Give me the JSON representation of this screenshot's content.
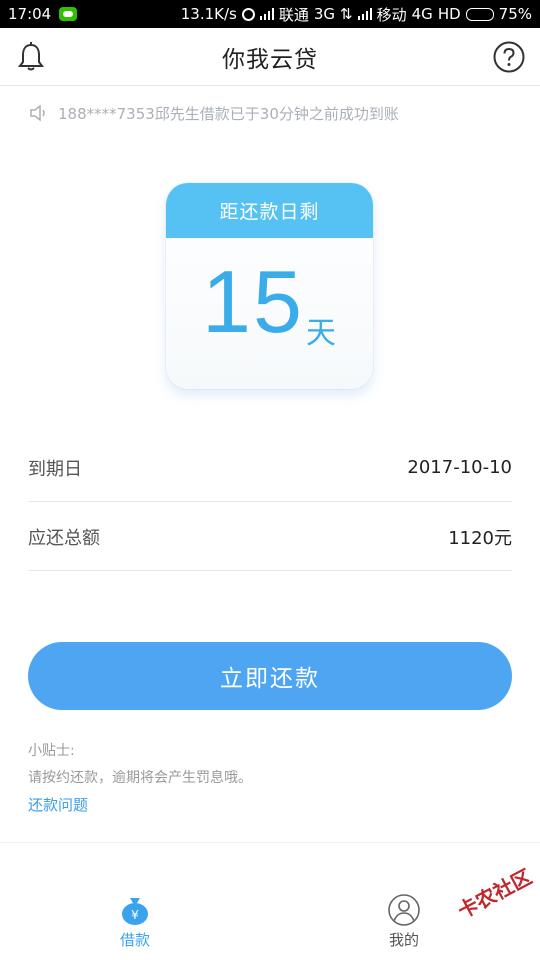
{
  "status_bar": {
    "time": "17:04",
    "net_speed": "13.1K/s",
    "carrier1": "联通",
    "net1": "3G",
    "carrier2": "移动",
    "net2": "4G",
    "hd": "HD",
    "battery": "75%",
    "battery_level": 0.75
  },
  "header": {
    "title": "你我云贷",
    "left_icon": "bell-icon",
    "right_icon": "help-circle-icon"
  },
  "notice": {
    "icon": "speaker-icon",
    "text": "188****7353邱先生借款已于30分钟之前成功到账"
  },
  "countdown": {
    "header": "距还款日剩",
    "days": "15",
    "unit": "天"
  },
  "details": [
    {
      "label": "到期日",
      "value": "2017-10-10"
    },
    {
      "label": "应还总额",
      "value": "1120元"
    }
  ],
  "action": {
    "button_label": "立即还款"
  },
  "tips": {
    "title": "小贴士:",
    "body": "请按约还款，逾期将会产生罚息哦。",
    "link": "还款问题"
  },
  "tabs": [
    {
      "label": "借款",
      "icon": "money-bag-icon",
      "active": true
    },
    {
      "label": "我的",
      "icon": "user-icon",
      "active": false
    }
  ],
  "watermark": {
    "text": "卡农社区"
  },
  "colors": {
    "accent": "#4ea6f2",
    "calendar_header": "#56c2f4",
    "number": "#3aace9",
    "link": "#3a9ee8"
  }
}
